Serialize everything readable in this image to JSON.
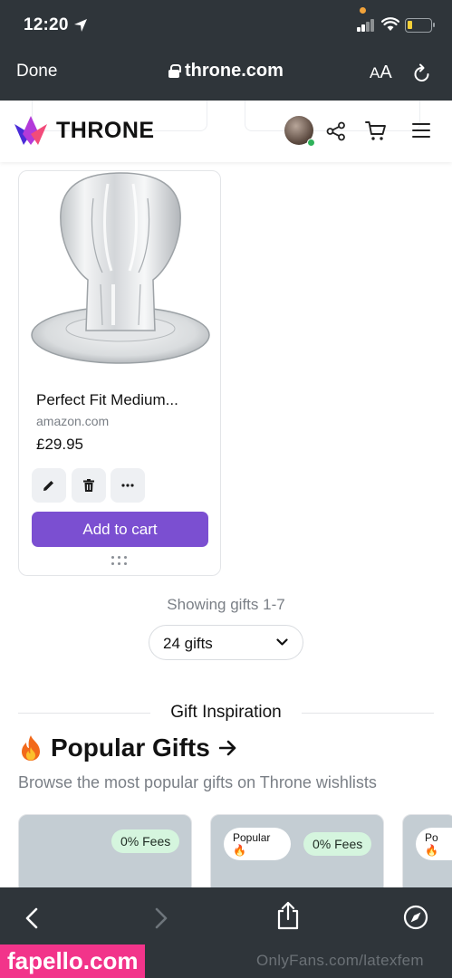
{
  "status_bar": {
    "time": "12:20"
  },
  "browser": {
    "done_label": "Done",
    "url": "throne.com",
    "text_size_label_small": "A",
    "text_size_label_large": "A"
  },
  "header": {
    "logo_text": "THRONE",
    "brand_colors": [
      "#4a2bd8",
      "#b33ad9",
      "#f24b7a"
    ],
    "online_color": "#2fb25a"
  },
  "product": {
    "name": "Perfect Fit Medium...",
    "store": "amazon.com",
    "price": "£29.95",
    "add_to_cart_label": "Add to cart",
    "accent_color": "#7b4fd1"
  },
  "pagination": {
    "showing_text": "Showing gifts 1-7",
    "per_page_selected": "24 gifts"
  },
  "inspiration": {
    "section_title": "Gift Inspiration",
    "heading": "Popular Gifts",
    "subtitle": "Browse the most popular gifts on Throne wishlists",
    "cards": [
      {
        "fees_label": "0% Fees"
      },
      {
        "badge_label": "Popular",
        "fees_label": "0% Fees"
      },
      {
        "badge_label": "Po"
      }
    ]
  },
  "watermarks": {
    "left": "fapello.com",
    "right": "OnlyFans.com/latexfem"
  }
}
